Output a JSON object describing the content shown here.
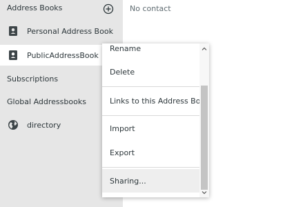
{
  "sidebar": {
    "address_books": {
      "title": "Address Books",
      "items": [
        {
          "label": "Personal Address Book",
          "icon": "address-book-icon"
        },
        {
          "label": "PublicAddressBook",
          "icon": "address-book-icon",
          "selected": true
        }
      ]
    },
    "subscriptions": {
      "title": "Subscriptions"
    },
    "global": {
      "title": "Global Addressbooks",
      "items": [
        {
          "label": "directory",
          "icon": "globe-icon"
        }
      ]
    }
  },
  "main": {
    "empty_text": "No contact"
  },
  "context_menu": {
    "items": [
      {
        "label": "Rename"
      },
      {
        "label": "Delete"
      },
      {
        "label": "Links to this Address Book"
      },
      {
        "label": "Import"
      },
      {
        "label": "Export"
      },
      {
        "label": "Sharing..."
      }
    ]
  },
  "colors": {
    "sidebar_bg": "#e6e6e6",
    "text": "#2c363a",
    "muted_text": "#5f6b71",
    "menu_hover": "#eeeeee"
  }
}
